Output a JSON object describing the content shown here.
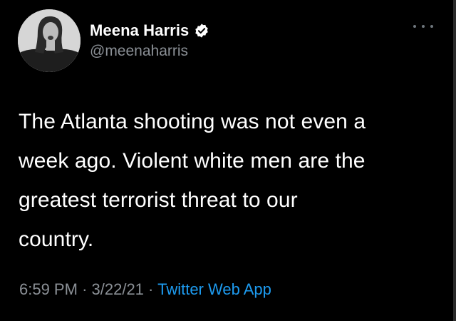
{
  "tweet": {
    "author": {
      "display_name": "Meena Harris",
      "handle": "@meenaharris",
      "verified_icon": "verified-badge-icon",
      "avatar_icon": "profile-avatar"
    },
    "more_icon": "more-options-icon",
    "text": "The Atlanta shooting was not even a\nweek ago. Violent white men are the\ngreatest terrorist threat to our\ncountry.",
    "time": "6:59 PM",
    "separator": "·",
    "date": "3/22/21",
    "source": "Twitter Web App"
  },
  "colors": {
    "background": "#000000",
    "text": "#ffffff",
    "secondary_text": "#8b9096",
    "link": "#1d9bf0"
  }
}
